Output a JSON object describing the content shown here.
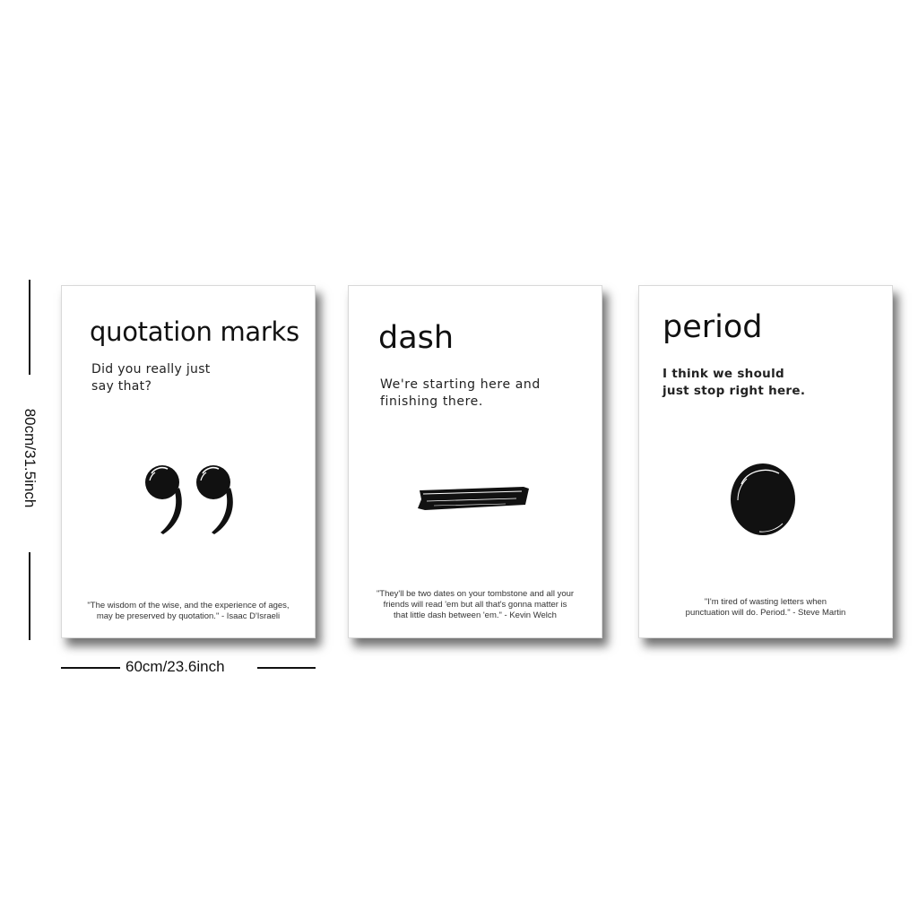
{
  "dimensions": {
    "height_label": "80cm/31.5inch",
    "width_label": "60cm/23.6inch"
  },
  "posters": [
    {
      "title": "quotation marks",
      "subtitle_lines": [
        "Did you really just",
        "say that?"
      ],
      "icon": "quotation-marks-icon",
      "quote_lines": [
        "\"The wisdom of the wise, and the experience of ages,",
        "may be preserved by quotation.\" - Isaac D'Israeli"
      ]
    },
    {
      "title": "dash",
      "subtitle_lines": [
        "We're starting here and",
        "finishing there."
      ],
      "icon": "dash-icon",
      "quote_lines": [
        "\"They'll be two dates on your tombstone and all your",
        "friends will read 'em but all that's gonna matter is",
        "that little dash between 'em.\" - Kevin Welch"
      ]
    },
    {
      "title": "period",
      "subtitle_lines": [
        "I think we should",
        "just stop right here."
      ],
      "icon": "period-icon",
      "quote_lines": [
        "\"I'm tired of wasting letters when",
        "punctuation will do.  Period.\" - Steve Martin"
      ]
    }
  ]
}
